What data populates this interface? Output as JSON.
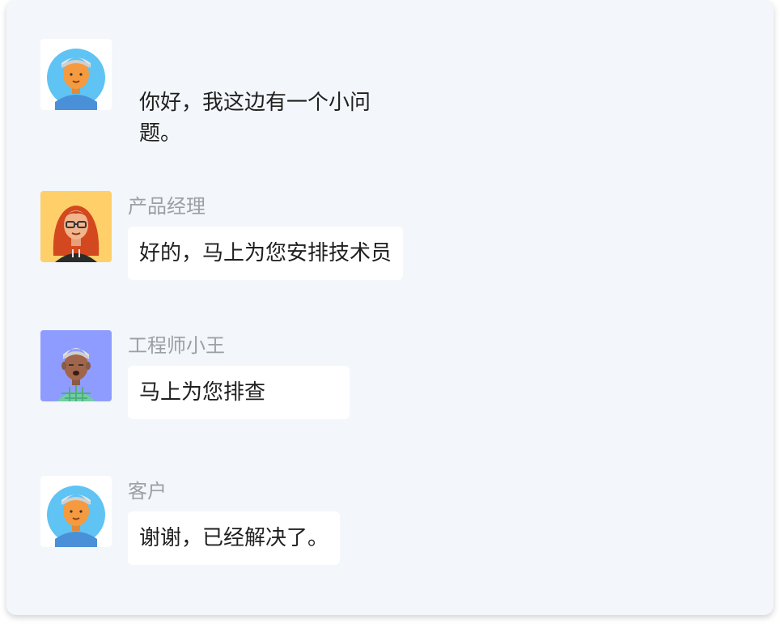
{
  "colors": {
    "panel_bg": "#f3f6fa",
    "bubble_bg": "#ffffff",
    "sender_text": "#9aa0a6",
    "message_text": "#1f1f1f"
  },
  "messages": [
    {
      "sender": "",
      "avatar": "customer-avatar-icon",
      "text": "你好，我这边有一个小问题。"
    },
    {
      "sender": "产品经理",
      "avatar": "product-manager-avatar-icon",
      "text": "好的，马上为您安排技术员"
    },
    {
      "sender": "工程师小王",
      "avatar": "engineer-avatar-icon",
      "text": "马上为您排查"
    },
    {
      "sender": "客户",
      "avatar": "customer-avatar-icon",
      "text": "谢谢，已经解决了。"
    }
  ]
}
